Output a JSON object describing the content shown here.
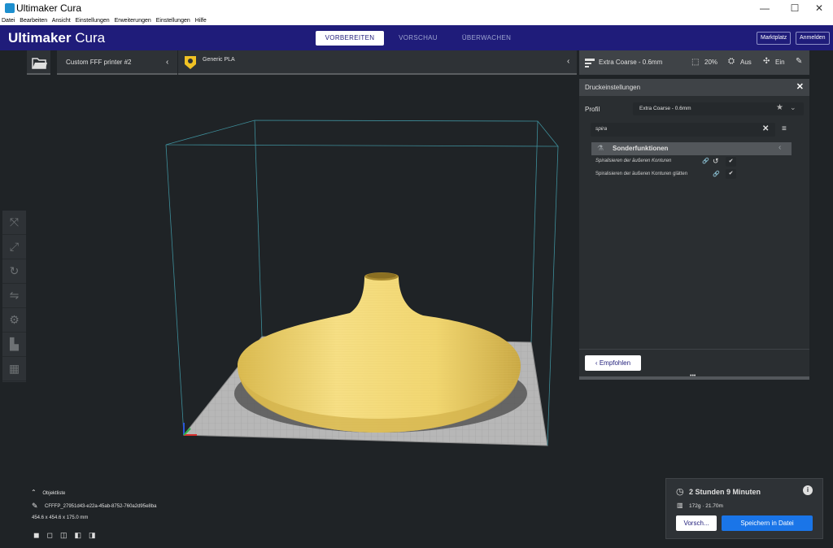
{
  "window": {
    "title": "Ultimaker Cura",
    "minimize": "—",
    "maximize": "☐",
    "close": "✕"
  },
  "menu": [
    "Datei",
    "Bearbeiten",
    "Ansicht",
    "Einstellungen",
    "Erweiterungen",
    "Einstellungen",
    "Hilfe"
  ],
  "header": {
    "logo_bold": "Ultimaker",
    "logo_light": " Cura",
    "tabs": [
      "VORBEREITEN",
      "VORSCHAU",
      "ÜBERWACHEN"
    ],
    "marketplace": "Marktplatz",
    "signin": "Anmelden"
  },
  "toolbar": {
    "printer": "Custom FFF printer #2",
    "material": "Generic PLA",
    "profile": "Extra Coarse - 0.6mm",
    "infill": "20%",
    "support": "Aus",
    "adhesion": "Ein"
  },
  "settings_panel": {
    "title": "Druckeinstellungen",
    "profile_label": "Profil",
    "profile_value": "Extra Coarse - 0.6mm",
    "search_value": "spira",
    "category": "Sonderfunktionen",
    "settings": [
      {
        "label": "Spiralisieren der äußeren Konturen",
        "checked": true
      },
      {
        "label": "Spiralisieren der äußeren Konturen glätten",
        "checked": true
      }
    ],
    "recommended_button": "Empfohlen"
  },
  "object_list": {
    "toggle_label": "Objektliste",
    "file_name": "CFFFP_27951d43-e22a-45ab-8752-760a2d95e8ba",
    "dimensions": "454.6 x 454.6 x 175.0 mm"
  },
  "print_job": {
    "time": "2 Stunden 9 Minuten",
    "material": "172g · 21.70m",
    "preview_button": "Vorsch...",
    "save_button": "Speichern in Datei"
  },
  "colors": {
    "header": "#1f1c7a",
    "model": "#f3d978",
    "accent_blue": "#1a75e8"
  }
}
